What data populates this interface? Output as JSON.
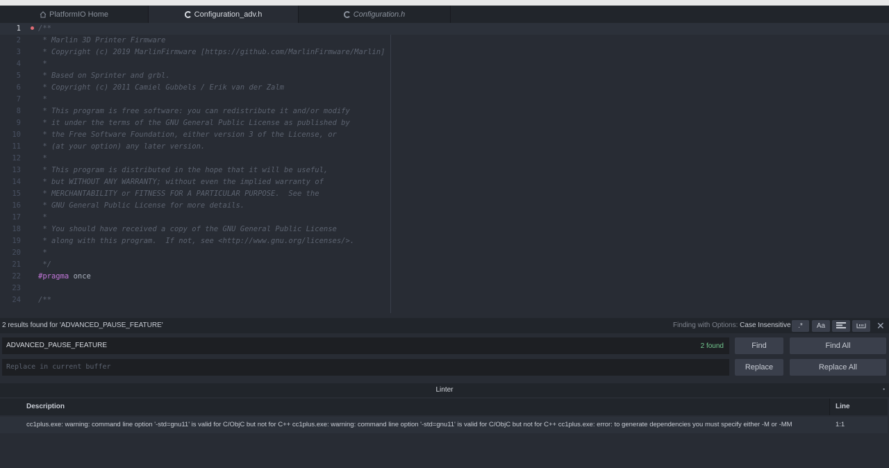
{
  "tabs": [
    {
      "label": "PlatformIO Home",
      "icon": "home-icon"
    },
    {
      "label": "Configuration_adv.h",
      "icon": "c-file-icon"
    },
    {
      "label": "Configuration.h",
      "icon": "c-file-icon"
    }
  ],
  "editor": {
    "lines": [
      {
        "num": "1",
        "text": "/**"
      },
      {
        "num": "2",
        "text": " * Marlin 3D Printer Firmware"
      },
      {
        "num": "3",
        "text": " * Copyright (c) 2019 MarlinFirmware [https://github.com/MarlinFirmware/Marlin]"
      },
      {
        "num": "4",
        "text": " *"
      },
      {
        "num": "5",
        "text": " * Based on Sprinter and grbl."
      },
      {
        "num": "6",
        "text": " * Copyright (c) 2011 Camiel Gubbels / Erik van der Zalm"
      },
      {
        "num": "7",
        "text": " *"
      },
      {
        "num": "8",
        "text": " * This program is free software: you can redistribute it and/or modify"
      },
      {
        "num": "9",
        "text": " * it under the terms of the GNU General Public License as published by"
      },
      {
        "num": "10",
        "text": " * the Free Software Foundation, either version 3 of the License, or"
      },
      {
        "num": "11",
        "text": " * (at your option) any later version."
      },
      {
        "num": "12",
        "text": " *"
      },
      {
        "num": "13",
        "text": " * This program is distributed in the hope that it will be useful,"
      },
      {
        "num": "14",
        "text": " * but WITHOUT ANY WARRANTY; without even the implied warranty of"
      },
      {
        "num": "15",
        "text": " * MERCHANTABILITY or FITNESS FOR A PARTICULAR PURPOSE.  See the"
      },
      {
        "num": "16",
        "text": " * GNU General Public License for more details."
      },
      {
        "num": "17",
        "text": " *"
      },
      {
        "num": "18",
        "text": " * You should have received a copy of the GNU General Public License"
      },
      {
        "num": "19",
        "text": " * along with this program.  If not, see <http://www.gnu.org/licenses/>."
      },
      {
        "num": "20",
        "text": " *"
      },
      {
        "num": "21",
        "text": " */"
      },
      {
        "num": "22",
        "keyword": "#pragma",
        "rest": " once"
      },
      {
        "num": "23",
        "text": ""
      },
      {
        "num": "24",
        "text": "/**"
      }
    ]
  },
  "find": {
    "status": "2 results found for 'ADVANCED_PAUSE_FEATURE'",
    "options_prefix": "Finding with Options:",
    "options_value": "Case Insensitive",
    "opt_regex": ".*",
    "opt_case": "Aa",
    "query": "ADVANCED_PAUSE_FEATURE",
    "count": "2 found",
    "find_label": "Find",
    "find_all_label": "Find All",
    "replace_placeholder": "Replace in current buffer",
    "replace_label": "Replace",
    "replace_all_label": "Replace All"
  },
  "linter": {
    "title": "Linter",
    "col_description": "Description",
    "col_line": "Line",
    "rows": [
      {
        "description": "cc1plus.exe: warning: command line option '-std=gnu11' is valid for C/ObjC but not for C++ cc1plus.exe: warning: command line option '-std=gnu11' is valid for C/ObjC but not for C++ cc1plus.exe: error: to generate dependencies you must specify either -M or -MM",
        "line": "1:1"
      }
    ]
  },
  "colors": {
    "background": "#282c34",
    "panel": "#21252b",
    "comment": "#5c6370",
    "keyword": "#c678dd",
    "found": "#73c990",
    "modified_dot": "#e06c75"
  }
}
